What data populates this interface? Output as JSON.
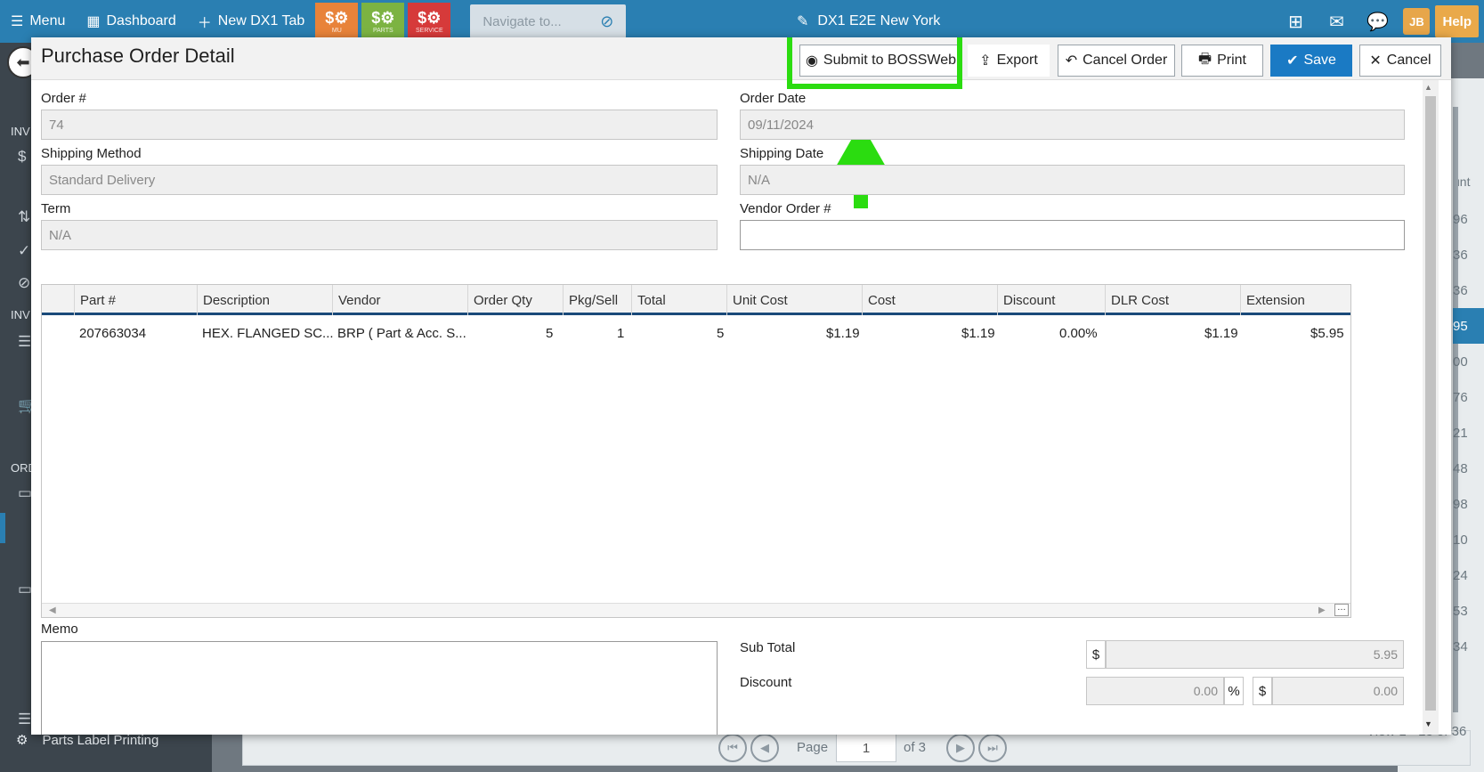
{
  "topbar": {
    "menu": "Menu",
    "dashboard": "Dashboard",
    "new_tab": "New DX1 Tab",
    "tiles": [
      {
        "label": "MU",
        "color": "#e8833a"
      },
      {
        "label": "PARTS",
        "color": "#7cb342"
      },
      {
        "label": "SERVICE",
        "color": "#d63a3a"
      }
    ],
    "navigate_placeholder": "Navigate to...",
    "store": "DX1 E2E New York",
    "avatar": "JB",
    "help": "Help"
  },
  "background": {
    "sidebar_sections": [
      "INV",
      "INV",
      "ORD"
    ],
    "sidebar_item": "Parts Label Printing",
    "grid_partial_header": "unt",
    "grid_numbers": [
      "96",
      "36",
      "36",
      "95",
      "00",
      "76",
      "21",
      "48",
      "98",
      "10",
      "24",
      "53",
      "34"
    ],
    "pager": {
      "page_label": "Page",
      "page_value": "1",
      "of_label": "of 3",
      "view_label": "View 1 - 13 of 36"
    }
  },
  "modal": {
    "title": "Purchase Order Detail",
    "buttons": {
      "submit": "Submit to BOSSWeb",
      "export": "Export",
      "cancel_order": "Cancel Order",
      "print": "Print",
      "save": "Save",
      "cancel": "Cancel"
    },
    "fields": {
      "order_no_label": "Order #",
      "order_no": "74",
      "order_date_label": "Order Date",
      "order_date": "09/11/2024",
      "ship_method_label": "Shipping Method",
      "ship_method": "Standard Delivery",
      "ship_date_label": "Shipping Date",
      "ship_date": "N/A",
      "term_label": "Term",
      "term": "N/A",
      "vendor_order_label": "Vendor Order #",
      "vendor_order": ""
    },
    "grid": {
      "columns": [
        "Part #",
        "Description",
        "Vendor",
        "Order Qty",
        "Pkg/Sell",
        "Total",
        "Unit Cost",
        "Cost",
        "Discount",
        "DLR Cost",
        "Extension"
      ],
      "rows": [
        {
          "part": "207663034",
          "description": "HEX. FLANGED SC...",
          "vendor": "BRP ( Part & Acc. S...",
          "order_qty": "5",
          "pkg_sell": "1",
          "total": "5",
          "unit_cost": "$1.19",
          "cost": "$1.19",
          "discount": "0.00%",
          "dlr_cost": "$1.19",
          "extension": "$5.95"
        }
      ]
    },
    "memo_label": "Memo",
    "totals": {
      "subtotal_label": "Sub Total",
      "subtotal_symbol": "$",
      "subtotal": "5.95",
      "discount_label": "Discount",
      "discount_pct": "0.00",
      "pct_symbol": "%",
      "discount_symbol": "$",
      "discount_amt": "0.00"
    },
    "highlight_color": "#2bdc10"
  }
}
